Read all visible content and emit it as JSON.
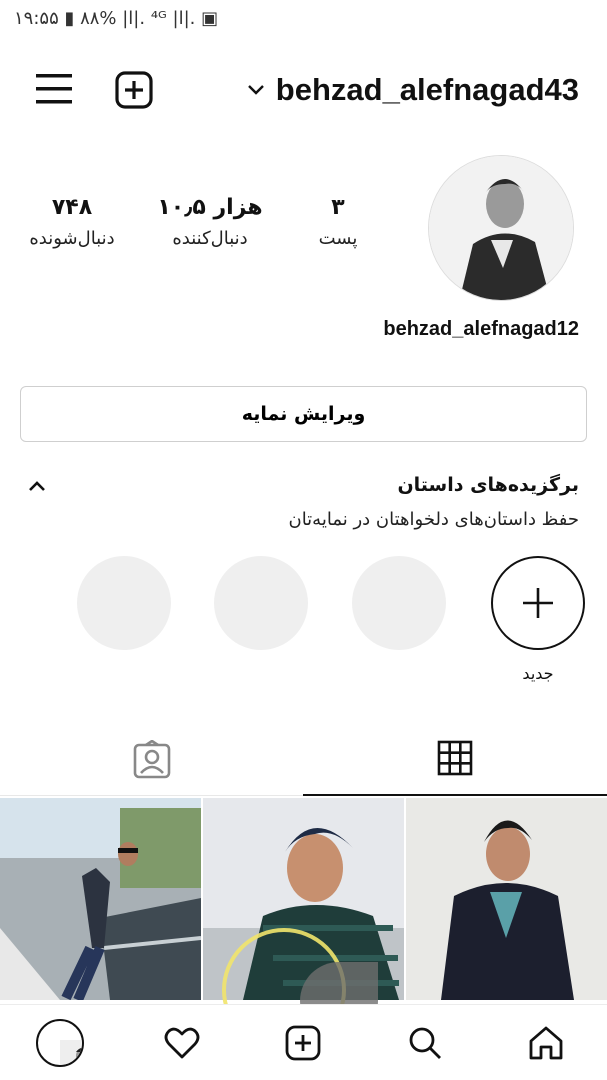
{
  "status_bar": {
    "text": "۱۹:۵۵ ▮ ۸۸% |l|. ⁴ᴳ |l|. ▣"
  },
  "header": {
    "username": "behzad_alefnagad43",
    "icons": [
      "menu-icon",
      "add-post-icon",
      "chevron-down-icon"
    ]
  },
  "profile": {
    "display_name": "behzad_alefnagad12",
    "stats": {
      "posts": {
        "value": "۳",
        "label": "پست"
      },
      "following": {
        "value": "۱۰٫۵ هزار",
        "label": "دنبال‌کننده"
      },
      "followers": {
        "value": "۷۴۸",
        "label": "دنبال‌شونده"
      }
    },
    "edit_button_label": "ویرایش نمایه"
  },
  "highlights": {
    "title": "برگزیده‌های داستان",
    "subtitle": "حفظ داستان‌های دلخواهتان در نمایه‌تان",
    "new_label": "جدید",
    "empty_count": 3
  },
  "tabs": [
    {
      "name": "grid",
      "icon": "grid-icon",
      "active": true
    },
    {
      "name": "tagged",
      "icon": "tagged-person-icon",
      "active": false
    }
  ],
  "posts_count_shown": 3,
  "bottom_nav": [
    "home-icon",
    "search-icon",
    "add-post-icon",
    "heart-icon",
    "profile-avatar"
  ],
  "colors": {
    "text": "#111111",
    "border": "#cfcfcf",
    "placeholder": "#efefef",
    "overlay_ring": "#f1e46c"
  }
}
